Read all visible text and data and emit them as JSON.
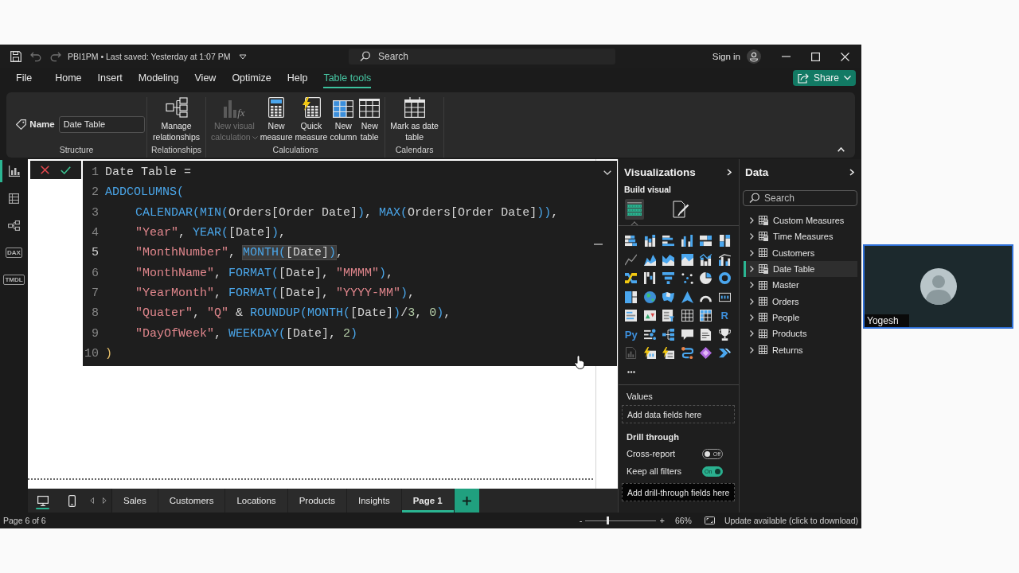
{
  "title_bar": {
    "title": "PBI1PM • Last saved: Yesterday at 1:07 PM",
    "search": {
      "placeholder": "Search"
    },
    "sign_in": "Sign in"
  },
  "menu": [
    {
      "label": "File",
      "selected": false
    },
    {
      "label": "Home",
      "selected": false
    },
    {
      "label": "Insert",
      "selected": false
    },
    {
      "label": "Modeling",
      "selected": false
    },
    {
      "label": "View",
      "selected": false
    },
    {
      "label": "Optimize",
      "selected": false
    },
    {
      "label": "Help",
      "selected": false
    },
    {
      "label": "Table tools",
      "selected": true
    }
  ],
  "share": {
    "label": "Share"
  },
  "ribbon": {
    "name_label": "Name",
    "name_value": "Date Table",
    "structure_label": "Structure",
    "groups": [
      {
        "label": "Relationships",
        "buttons": [
          {
            "kind": "relationships",
            "label": "Manage\nrelationships",
            "disabled": false,
            "has_menu": false
          }
        ]
      },
      {
        "label": "Calculations",
        "buttons": [
          {
            "kind": "visual-calculation",
            "label": "New visual\ncalculation",
            "icon_text": "fx",
            "disabled": true,
            "has_menu": true
          },
          {
            "kind": "measure",
            "label": "New\nmeasure",
            "disabled": false,
            "has_menu": false
          },
          {
            "kind": "quick-measure",
            "label": "Quick\nmeasure",
            "disabled": false,
            "has_menu": false
          },
          {
            "kind": "column",
            "label": "New\ncolumn",
            "disabled": false,
            "has_menu": false
          },
          {
            "kind": "table",
            "label": "New\ntable",
            "disabled": false,
            "has_menu": false
          }
        ]
      },
      {
        "label": "Calendars",
        "buttons": [
          {
            "kind": "calendar",
            "label": "Mark as date\ntable",
            "disabled": false,
            "has_menu": false
          }
        ]
      }
    ]
  },
  "rail": [
    {
      "kind": "report",
      "selected": true
    },
    {
      "kind": "table",
      "selected": false
    },
    {
      "kind": "model",
      "selected": false
    },
    {
      "kind": "dax",
      "label": "DAX",
      "selected": false
    },
    {
      "kind": "tmdl",
      "label": "TMDL",
      "selected": false
    }
  ],
  "editor": {
    "lines": [
      {
        "number": "1",
        "current": false,
        "tokens": [
          {
            "kind": "plain",
            "text": "Date Table ="
          }
        ]
      },
      {
        "number": "2",
        "current": false,
        "tokens": [
          {
            "kind": "function",
            "text": "ADDCOLUMNS("
          }
        ],
        "children": [
          {
            "number": "3",
            "current": false,
            "tokens": [
              {
                "kind": "function",
                "text": "CALENDAR(MIN("
              },
              {
                "kind": "plain",
                "text": "Orders[Order Date]"
              },
              {
                "kind": "function",
                "text": ")"
              },
              {
                "kind": "plain",
                "text": ", "
              },
              {
                "kind": "function",
                "text": "MAX("
              },
              {
                "kind": "plain",
                "text": "Orders[Order Date]"
              },
              {
                "kind": "function",
                "text": "))"
              },
              {
                "kind": "plain",
                "text": ","
              }
            ]
          },
          {
            "number": "4",
            "current": false,
            "tokens": [
              {
                "kind": "string",
                "text": "\"Year\""
              },
              {
                "kind": "plain",
                "text": ", "
              },
              {
                "kind": "function",
                "text": "YEAR("
              },
              {
                "kind": "plain",
                "text": "[Date]"
              },
              {
                "kind": "function",
                "text": ")"
              },
              {
                "kind": "plain",
                "text": ","
              }
            ]
          },
          {
            "number": "5",
            "current": true,
            "tokens": [
              {
                "kind": "string",
                "text": "\"MonthNumber\""
              },
              {
                "kind": "plain",
                "text": ", "
              },
              {
                "kind": "highlight",
                "tokens": [
                  {
                    "kind": "function",
                    "text": "MONTH("
                  },
                  {
                    "kind": "plain",
                    "text": "[Date]"
                  },
                  {
                    "kind": "function",
                    "text": ")"
                  }
                ]
              },
              {
                "kind": "plain",
                "text": ","
              }
            ]
          },
          {
            "number": "6",
            "current": false,
            "tokens": [
              {
                "kind": "string",
                "text": "\"MonthName\""
              },
              {
                "kind": "plain",
                "text": ", "
              },
              {
                "kind": "function",
                "text": "FORMAT("
              },
              {
                "kind": "plain",
                "text": "[Date], "
              },
              {
                "kind": "string",
                "text": "\"MMMM\""
              },
              {
                "kind": "function",
                "text": ")"
              },
              {
                "kind": "plain",
                "text": ","
              }
            ]
          },
          {
            "number": "7",
            "current": false,
            "tokens": [
              {
                "kind": "string",
                "text": "\"YearMonth\""
              },
              {
                "kind": "plain",
                "text": ", "
              },
              {
                "kind": "function",
                "text": "FORMAT("
              },
              {
                "kind": "plain",
                "text": "[Date], "
              },
              {
                "kind": "string",
                "text": "\"YYYY-MM\""
              },
              {
                "kind": "function",
                "text": ")"
              },
              {
                "kind": "plain",
                "text": ","
              }
            ]
          },
          {
            "number": "8",
            "current": false,
            "tokens": [
              {
                "kind": "string",
                "text": "\"Quater\""
              },
              {
                "kind": "plain",
                "text": ", "
              },
              {
                "kind": "string",
                "text": "\"Q\""
              },
              {
                "kind": "plain",
                "text": " & "
              },
              {
                "kind": "function",
                "text": "ROUNDUP(MONTH("
              },
              {
                "kind": "plain",
                "text": "[Date]"
              },
              {
                "kind": "function",
                "text": ")"
              },
              {
                "kind": "plain",
                "text": "/"
              },
              {
                "kind": "number",
                "text": "3"
              },
              {
                "kind": "plain",
                "text": ", "
              },
              {
                "kind": "number",
                "text": "0"
              },
              {
                "kind": "function",
                "text": ")"
              },
              {
                "kind": "plain",
                "text": ","
              }
            ]
          },
          {
            "number": "9",
            "current": false,
            "tokens": [
              {
                "kind": "string",
                "text": "\"DayOfWeek\""
              },
              {
                "kind": "plain",
                "text": ", "
              },
              {
                "kind": "function",
                "text": "WEEKDAY("
              },
              {
                "kind": "plain",
                "text": "[Date], "
              },
              {
                "kind": "number",
                "text": "2"
              },
              {
                "kind": "function",
                "text": ")"
              }
            ]
          }
        ]
      },
      {
        "number": "10",
        "current": false,
        "tokens": [
          {
            "kind": "bracket",
            "text": ")"
          }
        ]
      }
    ]
  },
  "page_tabs": {
    "views": [
      {
        "kind": "desktop",
        "selected": true
      },
      {
        "kind": "mobile",
        "selected": false
      }
    ],
    "pages": [
      {
        "label": "Sales",
        "selected": false
      },
      {
        "label": "Customers",
        "selected": false
      },
      {
        "label": "Locations",
        "selected": false
      },
      {
        "label": "Products",
        "selected": false
      },
      {
        "label": "Insights",
        "selected": false
      },
      {
        "label": "Page 1",
        "selected": true
      }
    ]
  },
  "visualizations": {
    "title": "Visualizations",
    "subtitle": "Build visual",
    "tabs": [
      {
        "kind": "build",
        "selected": true
      },
      {
        "kind": "format",
        "selected": false
      }
    ],
    "visuals": [
      {
        "kind": "stacked-bar"
      },
      {
        "kind": "stacked-column"
      },
      {
        "kind": "clustered-bar"
      },
      {
        "kind": "clustered-column"
      },
      {
        "kind": "percent-bar"
      },
      {
        "kind": "percent-column"
      },
      {
        "kind": "line"
      },
      {
        "kind": "area"
      },
      {
        "kind": "stacked-area"
      },
      {
        "kind": "percent-area"
      },
      {
        "kind": "line-stacked-column"
      },
      {
        "kind": "line-clustered-column"
      },
      {
        "kind": "ribbon"
      },
      {
        "kind": "waterfall"
      },
      {
        "kind": "funnel"
      },
      {
        "kind": "scatter"
      },
      {
        "kind": "pie"
      },
      {
        "kind": "donut"
      },
      {
        "kind": "treemap"
      },
      {
        "kind": "globe"
      },
      {
        "kind": "filled-map"
      },
      {
        "kind": "navigation-map"
      },
      {
        "kind": "gauge"
      },
      {
        "kind": "card"
      },
      {
        "kind": "multi-row-card"
      },
      {
        "kind": "kpi"
      },
      {
        "kind": "slicer"
      },
      {
        "kind": "table"
      },
      {
        "kind": "matrix"
      },
      {
        "kind": "script",
        "label": "R"
      },
      {
        "kind": "script",
        "label": "Py"
      },
      {
        "kind": "key-influencers"
      },
      {
        "kind": "decomposition"
      },
      {
        "kind": "qa"
      },
      {
        "kind": "narrative"
      },
      {
        "kind": "trophy"
      },
      {
        "kind": "paginated-report"
      },
      {
        "kind": "lightning-card"
      },
      {
        "kind": "lightning-slicer"
      },
      {
        "kind": "path-map"
      },
      {
        "kind": "diamond"
      },
      {
        "kind": "double-chevron"
      }
    ],
    "values": {
      "label": "Values",
      "placeholder": "Add data fields here"
    },
    "drill_through": {
      "title": "Drill through",
      "toggles": [
        {
          "label": "Cross-report",
          "on": false,
          "text": "Off"
        },
        {
          "label": "Keep all filters",
          "on": true,
          "text": "On"
        }
      ],
      "placeholder": "Add drill-through fields here"
    }
  },
  "data": {
    "title": "Data",
    "search": {
      "placeholder": "Search"
    },
    "tables": [
      {
        "name": "Custom Measures",
        "kind": "calculated",
        "expanded": false,
        "selected": false
      },
      {
        "name": "Time Measures",
        "kind": "calculated",
        "expanded": false,
        "selected": false
      },
      {
        "name": "Customers",
        "kind": "table",
        "expanded": false,
        "selected": false
      },
      {
        "name": "Date Table",
        "kind": "calculated",
        "expanded": false,
        "selected": true
      },
      {
        "name": "Master",
        "kind": "table",
        "expanded": false,
        "selected": false
      },
      {
        "name": "Orders",
        "kind": "table",
        "expanded": false,
        "selected": false
      },
      {
        "name": "People",
        "kind": "table",
        "expanded": false,
        "selected": false
      },
      {
        "name": "Products",
        "kind": "table",
        "expanded": false,
        "selected": false
      },
      {
        "name": "Returns",
        "kind": "table",
        "expanded": false,
        "selected": false
      }
    ]
  },
  "status_bar": {
    "page": "Page 6 of 6",
    "zoom_out": "-",
    "zoom": {
      "level": 0.32
    },
    "zoom_in": "+",
    "zoom_value": "66%",
    "update": "Update available (click to download)"
  },
  "video_tile": {
    "name": "Yogesh"
  }
}
